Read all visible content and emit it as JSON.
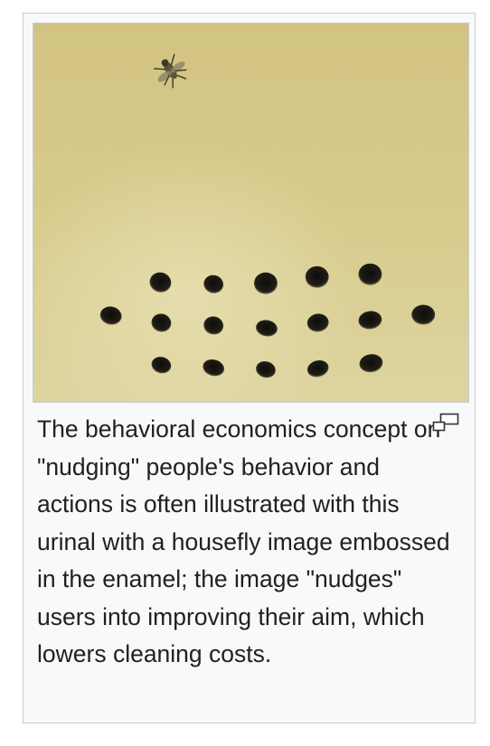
{
  "figure": {
    "image_subject": "urinal with housefly image embossed in the enamel",
    "caption": "The behavioral economics concept on \"nudging\" people's behavior and actions is often illustrated with this urinal with a housefly image embossed in the enamel; the image \"nudges\" users into improving their aim, which lowers cleaning costs.",
    "enlarge_icon": "magnify-clip-icon"
  },
  "colors": {
    "frame_border": "#c8ccd1",
    "frame_background": "#f8f9fa",
    "caption_text": "#202122",
    "enamel": "#d4c787",
    "drain_hole": "#1c1c18"
  }
}
